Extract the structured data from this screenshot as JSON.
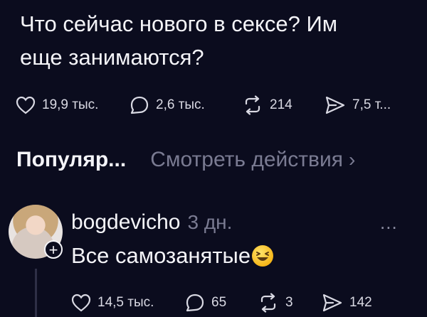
{
  "post": {
    "text": "Что сейчас нового в сексе? Им\nеще занимаются?",
    "stats": {
      "likes": "19,9 тыс.",
      "comments": "2,6 тыс.",
      "reposts": "214",
      "shares": "7,5 т..."
    }
  },
  "tabs": {
    "popular": "Популяр...",
    "activity": "Смотреть действия",
    "activity_chevron": "›"
  },
  "reply": {
    "username": "bogdevicho",
    "time": "3 дн.",
    "more": "...",
    "text": "Все самозанятые",
    "follow_badge": "+",
    "emoji": "laughing-squint-emoji",
    "stats": {
      "likes": "14,5 тыс.",
      "comments": "65",
      "reposts": "3",
      "shares": "142"
    }
  },
  "colors": {
    "background": "#0b0c1e",
    "text": "#f4f4f8",
    "muted": "#7a7b92"
  }
}
